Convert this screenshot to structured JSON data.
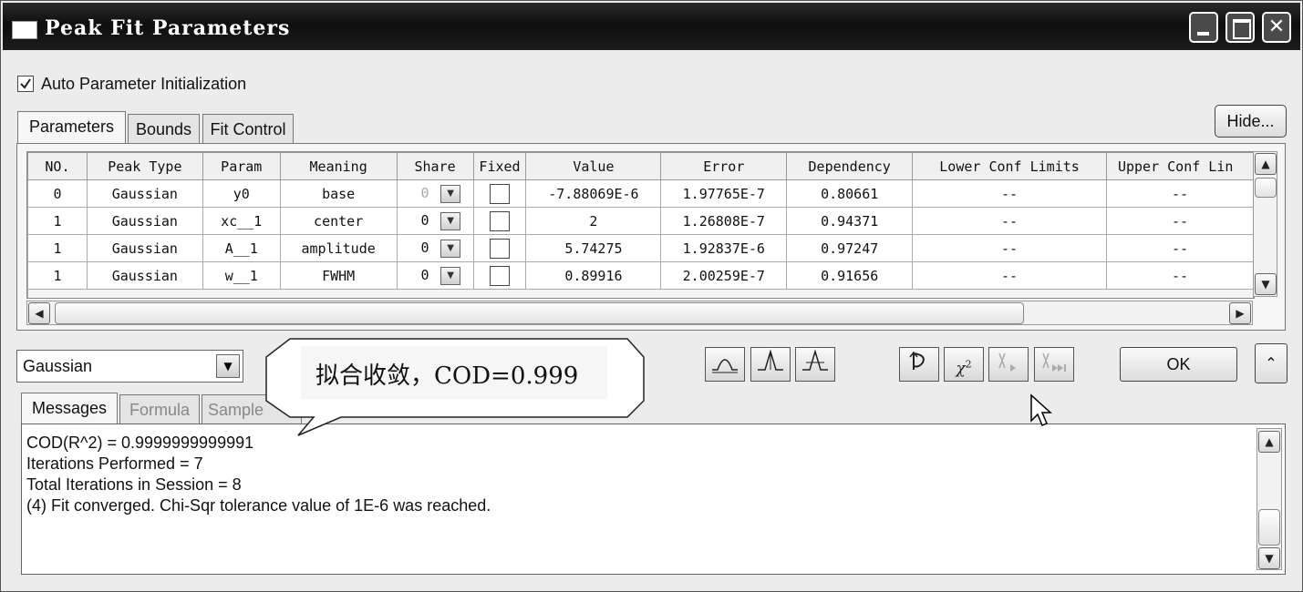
{
  "window": {
    "title": "Peak Fit Parameters"
  },
  "auto_init": {
    "label": "Auto Parameter Initialization",
    "checked": true
  },
  "tabs": [
    {
      "label": "Parameters",
      "active": true
    },
    {
      "label": "Bounds",
      "active": false
    },
    {
      "label": "Fit Control",
      "active": false
    }
  ],
  "hide_button": {
    "label": "Hide..."
  },
  "table": {
    "headers": [
      "NO.",
      "Peak Type",
      "Param",
      "Meaning",
      "Share",
      "Fixed",
      "Value",
      "Error",
      "Dependency",
      "Lower Conf Limits",
      "Upper Conf Lin"
    ],
    "rows": [
      {
        "no": "0",
        "peak_type": "Gaussian",
        "param": "y0",
        "meaning": "base",
        "share": "0",
        "share_disabled": true,
        "value": "-7.88069E-6",
        "error": "1.97765E-7",
        "dependency": "0.80661",
        "lower": "--",
        "upper": "--"
      },
      {
        "no": "1",
        "peak_type": "Gaussian",
        "param": "xc__1",
        "meaning": "center",
        "share": "0",
        "share_disabled": false,
        "value": "2",
        "error": "1.26808E-7",
        "dependency": "0.94371",
        "lower": "--",
        "upper": "--"
      },
      {
        "no": "1",
        "peak_type": "Gaussian",
        "param": "A__1",
        "meaning": "amplitude",
        "share": "0",
        "share_disabled": false,
        "value": "5.74275",
        "error": "1.92837E-6",
        "dependency": "0.97247",
        "lower": "--",
        "upper": "--"
      },
      {
        "no": "1",
        "peak_type": "Gaussian",
        "param": "w__1",
        "meaning": "FWHM",
        "share": "0",
        "share_disabled": false,
        "value": "0.89916",
        "error": "2.00259E-7",
        "dependency": "0.91656",
        "lower": "--",
        "upper": "--"
      }
    ]
  },
  "peak_function": {
    "selected": "Gaussian"
  },
  "ok_button": {
    "label": "OK"
  },
  "lower_tabs": [
    {
      "label": "Messages",
      "active": true
    },
    {
      "label": "Formula",
      "active": false
    },
    {
      "label": "Sample Curve",
      "active": false
    }
  ],
  "messages": [
    "COD(R^2) = 0.9999999999991",
    "Iterations Performed = 7",
    "Total Iterations in Session = 8",
    "(4) Fit converged. Chi-Sqr tolerance value of 1E-6 was reached."
  ],
  "annotation": {
    "text": "拟合收敛，COD=0.999"
  },
  "icons": {
    "tool_1": "peak-shape-icon",
    "tool_2": "peak-shape-icon",
    "tool_3": "peak-shape-icon",
    "tool_4": "undo-icon",
    "tool_5": "chi-square-icon",
    "tool_6": "fit-one-iteration-icon",
    "tool_7": "fit-until-converged-icon"
  }
}
